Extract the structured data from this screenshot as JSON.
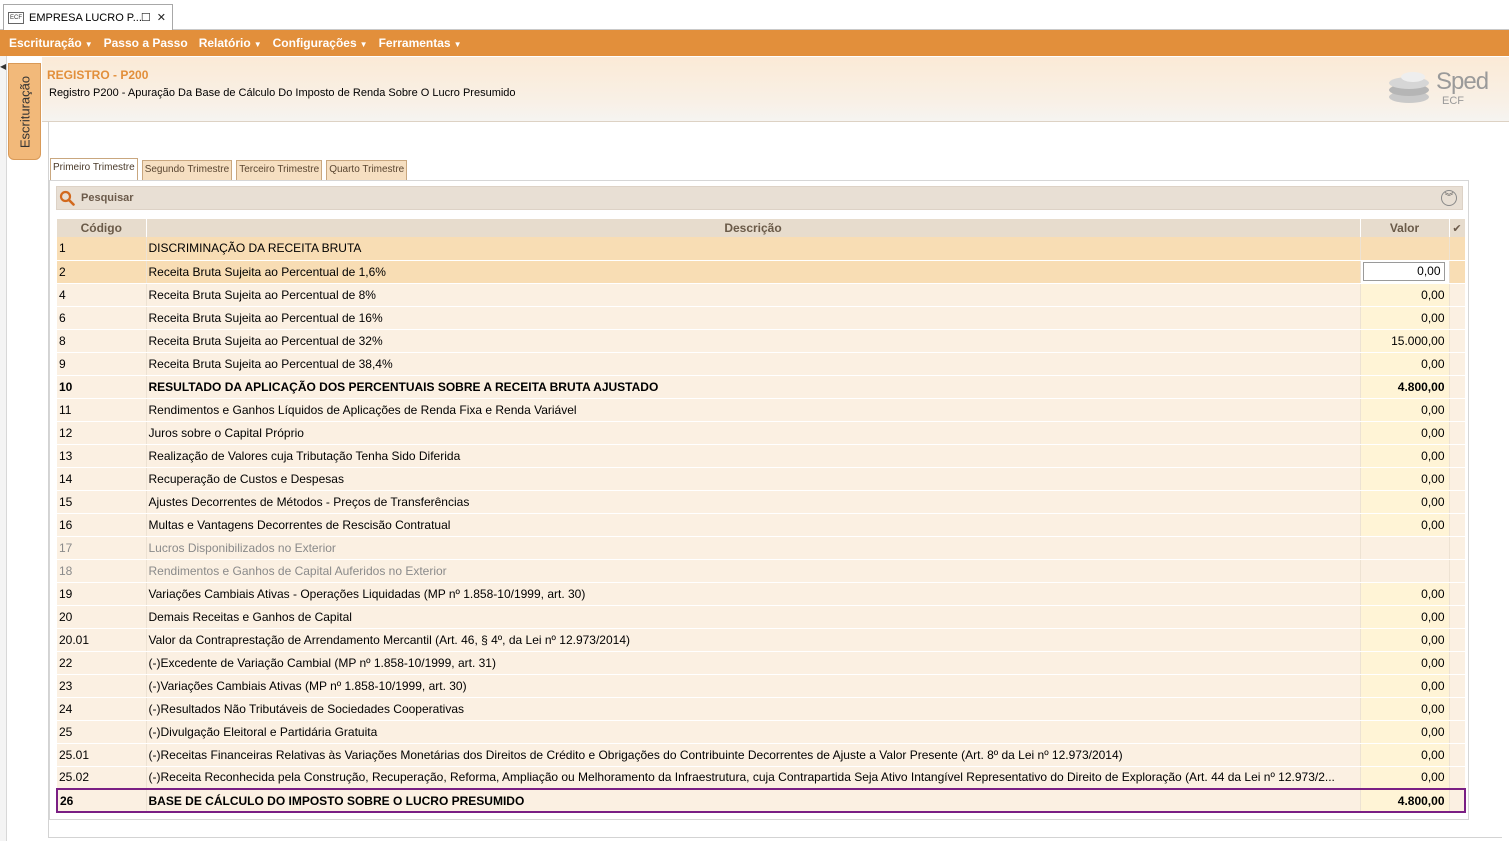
{
  "window": {
    "tab_title": "EMPRESA LUCRO P...",
    "app_icon": "ecf-icon",
    "maximize_glyph": "☐",
    "close_glyph": "✕"
  },
  "menu": {
    "items": [
      {
        "label": "Escrituração",
        "has_dropdown": true
      },
      {
        "label": "Passo a Passo",
        "has_dropdown": false
      },
      {
        "label": "Relatório",
        "has_dropdown": true
      },
      {
        "label": "Configurações",
        "has_dropdown": true
      },
      {
        "label": "Ferramentas",
        "has_dropdown": true
      }
    ],
    "caret": "▼"
  },
  "side_tab": {
    "label": "Escrituração"
  },
  "header": {
    "title": "REGISTRO - P200",
    "subtitle": "Registro P200 - Apuração Da Base de Cálculo Do Imposto de Renda Sobre O Lucro Presumido",
    "logo_text": "Sped",
    "logo_sub": "ECF"
  },
  "quarter_tabs": [
    {
      "label": "Primeiro Trimestre",
      "active": true
    },
    {
      "label": "Segundo Trimestre",
      "active": false
    },
    {
      "label": "Terceiro Trimestre",
      "active": false
    },
    {
      "label": "Quarto Trimestre",
      "active": false
    }
  ],
  "search": {
    "label": "Pesquisar",
    "expand_glyph": "︾"
  },
  "table": {
    "columns": {
      "code": "Código",
      "description": "Descrição",
      "value": "Valor",
      "check": "✔"
    },
    "rows": [
      {
        "code": "1",
        "description": "DISCRIMINAÇÃO DA RECEITA BRUTA",
        "value": "",
        "style": "sel"
      },
      {
        "code": "2",
        "description": "Receita Bruta Sujeita ao Percentual de 1,6%",
        "value": "0,00",
        "style": "sel",
        "editing": true
      },
      {
        "code": "4",
        "description": "Receita Bruta Sujeita ao Percentual de 8%",
        "value": "0,00",
        "style": ""
      },
      {
        "code": "6",
        "description": "Receita Bruta Sujeita ao Percentual de 16%",
        "value": "0,00",
        "style": ""
      },
      {
        "code": "8",
        "description": "Receita Bruta Sujeita ao Percentual de 32%",
        "value": "15.000,00",
        "style": ""
      },
      {
        "code": "9",
        "description": "Receita Bruta Sujeita ao Percentual de 38,4%",
        "value": "0,00",
        "style": ""
      },
      {
        "code": "10",
        "description": "RESULTADO DA APLICAÇÃO DOS PERCENTUAIS SOBRE A RECEITA BRUTA AJUSTADO",
        "value": "4.800,00",
        "style": "bold"
      },
      {
        "code": "11",
        "description": "Rendimentos e Ganhos Líquidos de Aplicações de Renda Fixa e Renda Variável",
        "value": "0,00",
        "style": ""
      },
      {
        "code": "12",
        "description": "Juros sobre o Capital Próprio",
        "value": "0,00",
        "style": ""
      },
      {
        "code": "13",
        "description": "Realização de Valores cuja Tributação Tenha Sido Diferida",
        "value": "0,00",
        "style": ""
      },
      {
        "code": "14",
        "description": "Recuperação de Custos e Despesas",
        "value": "0,00",
        "style": ""
      },
      {
        "code": "15",
        "description": "Ajustes Decorrentes de Métodos - Preços de Transferências",
        "value": "0,00",
        "style": ""
      },
      {
        "code": "16",
        "description": "Multas e Vantagens Decorrentes de Rescisão Contratual",
        "value": "0,00",
        "style": ""
      },
      {
        "code": "17",
        "description": "Lucros Disponibilizados no Exterior",
        "value": "",
        "style": "disabled"
      },
      {
        "code": "18",
        "description": "Rendimentos e Ganhos de Capital Auferidos no Exterior",
        "value": "",
        "style": "disabled"
      },
      {
        "code": "19",
        "description": "Variações Cambiais Ativas - Operações Liquidadas (MP nº 1.858-10/1999, art. 30)",
        "value": "0,00",
        "style": ""
      },
      {
        "code": "20",
        "description": "Demais Receitas e Ganhos de Capital",
        "value": "0,00",
        "style": ""
      },
      {
        "code": "20.01",
        "description": "Valor da Contraprestação de Arrendamento Mercantil (Art. 46, § 4º, da Lei nº 12.973/2014)",
        "value": "0,00",
        "style": ""
      },
      {
        "code": "22",
        "description": "(-)Excedente de Variação Cambial (MP nº 1.858-10/1999, art. 31)",
        "value": "0,00",
        "style": ""
      },
      {
        "code": "23",
        "description": "(-)Variações Cambiais Ativas (MP nº 1.858-10/1999, art. 30)",
        "value": "0,00",
        "style": ""
      },
      {
        "code": "24",
        "description": "(-)Resultados Não Tributáveis de Sociedades Cooperativas",
        "value": "0,00",
        "style": ""
      },
      {
        "code": "25",
        "description": "(-)Divulgação Eleitoral e Partidária Gratuita",
        "value": "0,00",
        "style": ""
      },
      {
        "code": "25.01",
        "description": "(-)Receitas Financeiras Relativas às Variações Monetárias dos Direitos de Crédito e Obrigações do Contribuinte Decorrentes de Ajuste a Valor Presente (Art. 8º da Lei nº 12.973/2014)",
        "value": "0,00",
        "style": ""
      },
      {
        "code": "25.02",
        "description": "(-)Receita Reconhecida pela Construção, Recuperação, Reforma, Ampliação ou Melhoramento da Infraestrutura, cuja Contrapartida Seja Ativo Intangível Representativo do Direito de Exploração (Art. 44 da Lei nº 12.973/2...",
        "value": "0,00",
        "style": ""
      },
      {
        "code": "26",
        "description": "BASE DE CÁLCULO DO IMPOSTO SOBRE O LUCRO PRESUMIDO",
        "value": "4.800,00",
        "style": "bold hl"
      }
    ]
  },
  "colors": {
    "menu_bar": "#e28f3b",
    "header_title": "#e28f3b",
    "highlight_border": "#7a1f84",
    "row_bg": "#fbf0e2",
    "value_bg": "#fff4d6",
    "selected_row": "#f8ddb4"
  }
}
